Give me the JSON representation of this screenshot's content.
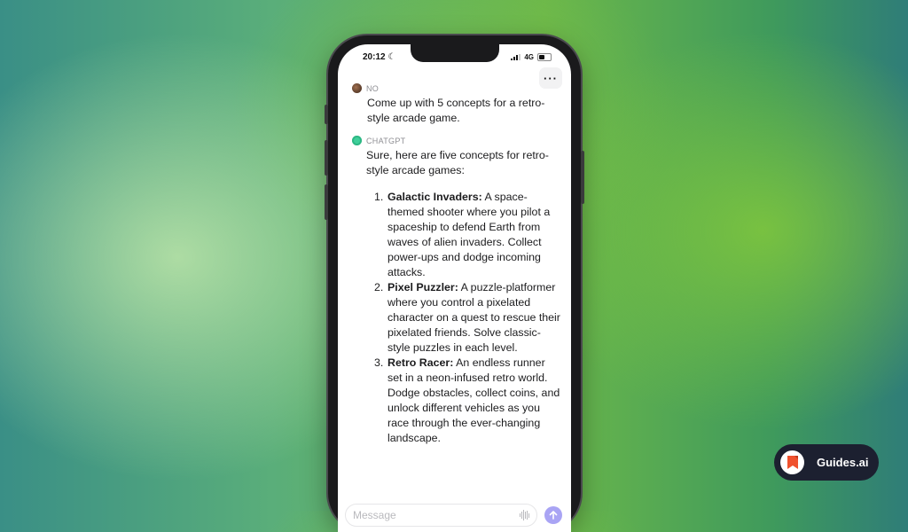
{
  "status_bar": {
    "time": "20:12",
    "network": "4G"
  },
  "conversation": {
    "user_message": {
      "sender": "NO",
      "text": "Come up with 5 concepts for a retro-style arcade game."
    },
    "assistant_message": {
      "sender": "CHATGPT",
      "intro": "Sure, here are five concepts for retro-style arcade games:",
      "items": [
        {
          "number": "1.",
          "title": "Galactic Invaders:",
          "body": " A space-themed shooter where you pilot a spaceship to defend Earth from waves of alien invaders. Collect power-ups and dodge incoming attacks."
        },
        {
          "number": "2.",
          "title": "Pixel Puzzler:",
          "body": " A puzzle-platformer where you control a pixelated character on a quest to rescue their pixelated friends. Solve classic-style puzzles in each level."
        },
        {
          "number": "3.",
          "title": "Retro Racer:",
          "body": " An endless runner set in a neon-infused retro world. Dodge obstacles, collect coins, and unlock different vehicles as you race through the ever-changing landscape."
        }
      ]
    }
  },
  "composer": {
    "placeholder": "Message"
  },
  "badge": {
    "label": "Guides.ai",
    "accent": "#f0512e"
  },
  "colors": {
    "send_button": "#a9a4f4",
    "gpt_avatar": "#3fcf9a"
  }
}
